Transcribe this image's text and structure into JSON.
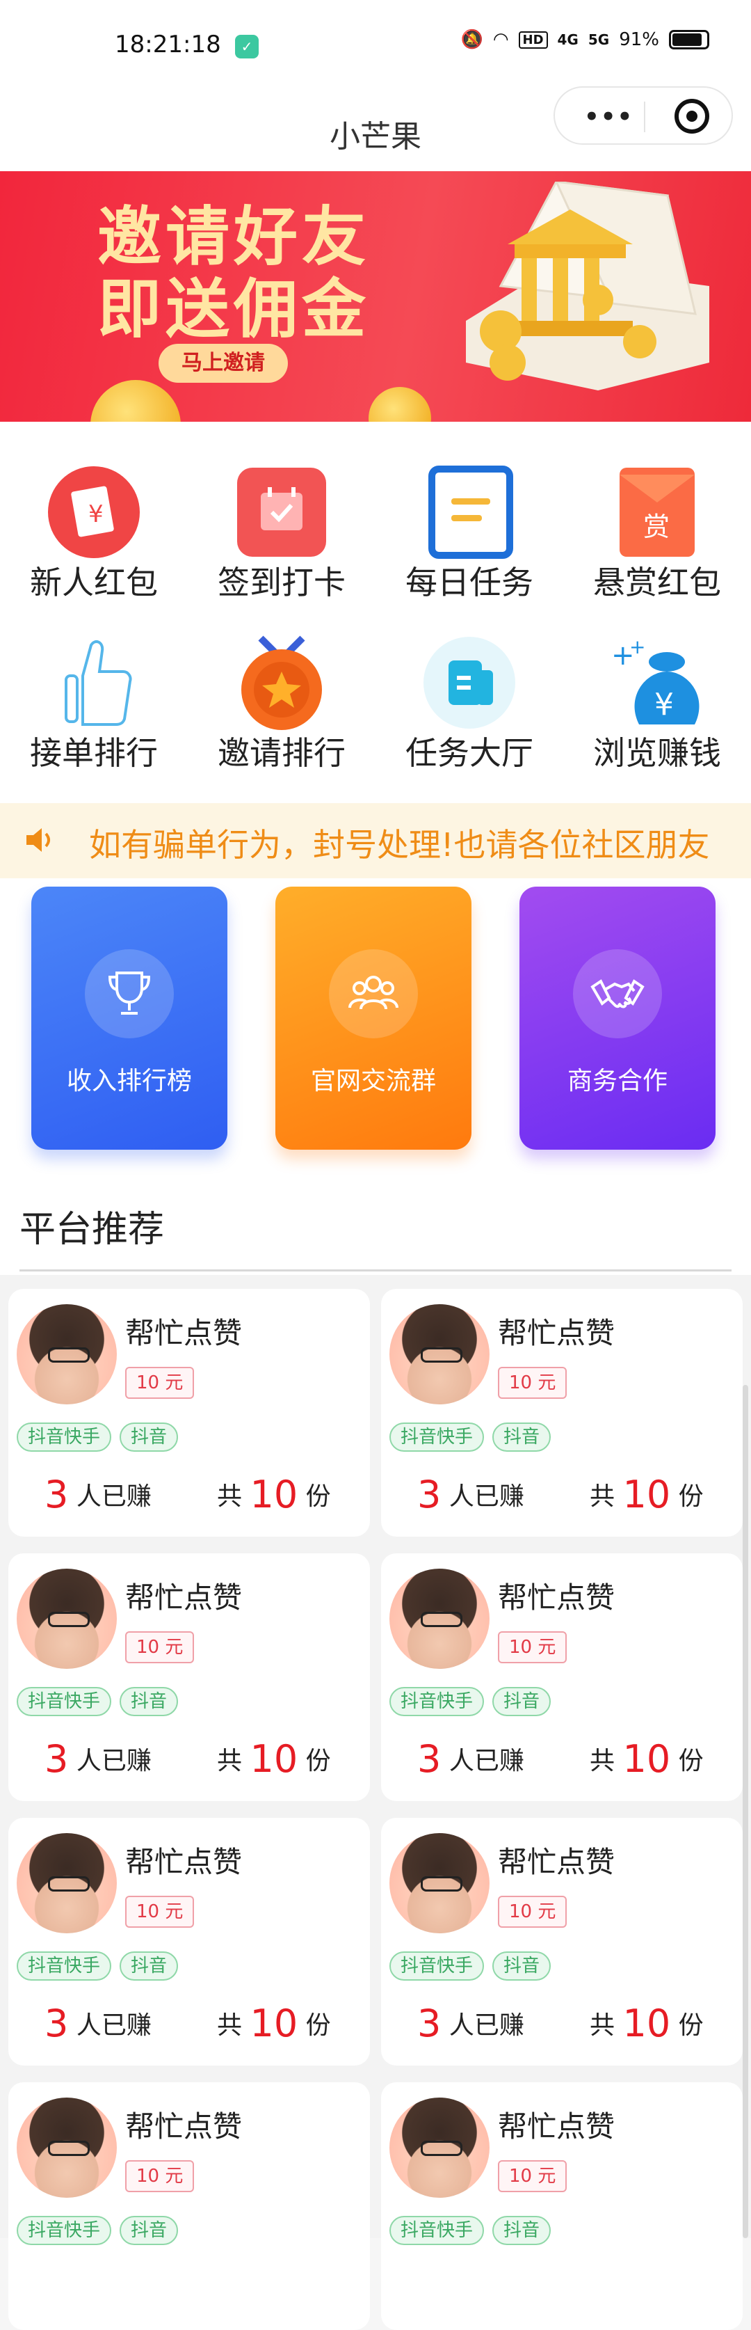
{
  "statusbar": {
    "time": "18:21:18",
    "hd": "HD",
    "net1": "4G",
    "net2": "5G",
    "battery": "91%"
  },
  "navbar": {
    "title": "小芒果",
    "more": "•••"
  },
  "banner": {
    "line1": "邀请好友",
    "line2": "即送佣金",
    "button": "马上邀请"
  },
  "grid": [
    {
      "label": "新人红包",
      "icon": "red-envelope-icon"
    },
    {
      "label": "签到打卡",
      "icon": "calendar-check-icon"
    },
    {
      "label": "每日任务",
      "icon": "task-list-icon"
    },
    {
      "label": "悬赏红包",
      "icon": "reward-envelope-icon"
    },
    {
      "label": "接单排行",
      "icon": "thumbs-up-icon"
    },
    {
      "label": "邀请排行",
      "icon": "medal-icon"
    },
    {
      "label": "任务大厅",
      "icon": "task-hall-icon"
    },
    {
      "label": "浏览赚钱",
      "icon": "money-bag-icon"
    }
  ],
  "notice": {
    "text": "如有骗单行为，封号处理!也请各位社区朋友"
  },
  "cards": [
    {
      "label": "收入排行榜",
      "icon": "trophy-icon",
      "color": "#3d6ef5"
    },
    {
      "label": "官网交流群",
      "icon": "group-icon",
      "color": "#ff8a1a"
    },
    {
      "label": "商务合作",
      "icon": "handshake-icon",
      "color": "#8a3ff0"
    }
  ],
  "section": {
    "title": "平台推荐"
  },
  "tasks": [
    {
      "name": "帮忙点赞",
      "price": "10 元",
      "tags": [
        "抖音快手",
        "抖音"
      ],
      "earned": "3",
      "earned_label": "人已赚",
      "total_prefix": "共",
      "total": "10",
      "total_unit": "份"
    },
    {
      "name": "帮忙点赞",
      "price": "10 元",
      "tags": [
        "抖音快手",
        "抖音"
      ],
      "earned": "3",
      "earned_label": "人已赚",
      "total_prefix": "共",
      "total": "10",
      "total_unit": "份"
    },
    {
      "name": "帮忙点赞",
      "price": "10 元",
      "tags": [
        "抖音快手",
        "抖音"
      ],
      "earned": "3",
      "earned_label": "人已赚",
      "total_prefix": "共",
      "total": "10",
      "total_unit": "份"
    },
    {
      "name": "帮忙点赞",
      "price": "10 元",
      "tags": [
        "抖音快手",
        "抖音"
      ],
      "earned": "3",
      "earned_label": "人已赚",
      "total_prefix": "共",
      "total": "10",
      "total_unit": "份"
    },
    {
      "name": "帮忙点赞",
      "price": "10 元",
      "tags": [
        "抖音快手",
        "抖音"
      ],
      "earned": "3",
      "earned_label": "人已赚",
      "total_prefix": "共",
      "total": "10",
      "total_unit": "份"
    },
    {
      "name": "帮忙点赞",
      "price": "10 元",
      "tags": [
        "抖音快手",
        "抖音"
      ],
      "earned": "3",
      "earned_label": "人已赚",
      "total_prefix": "共",
      "total": "10",
      "total_unit": "份"
    },
    {
      "name": "帮忙点赞",
      "price": "10 元",
      "tags": [
        "抖音快手",
        "抖音"
      ]
    },
    {
      "name": "帮忙点赞",
      "price": "10 元",
      "tags": [
        "抖音快手",
        "抖音"
      ]
    }
  ]
}
